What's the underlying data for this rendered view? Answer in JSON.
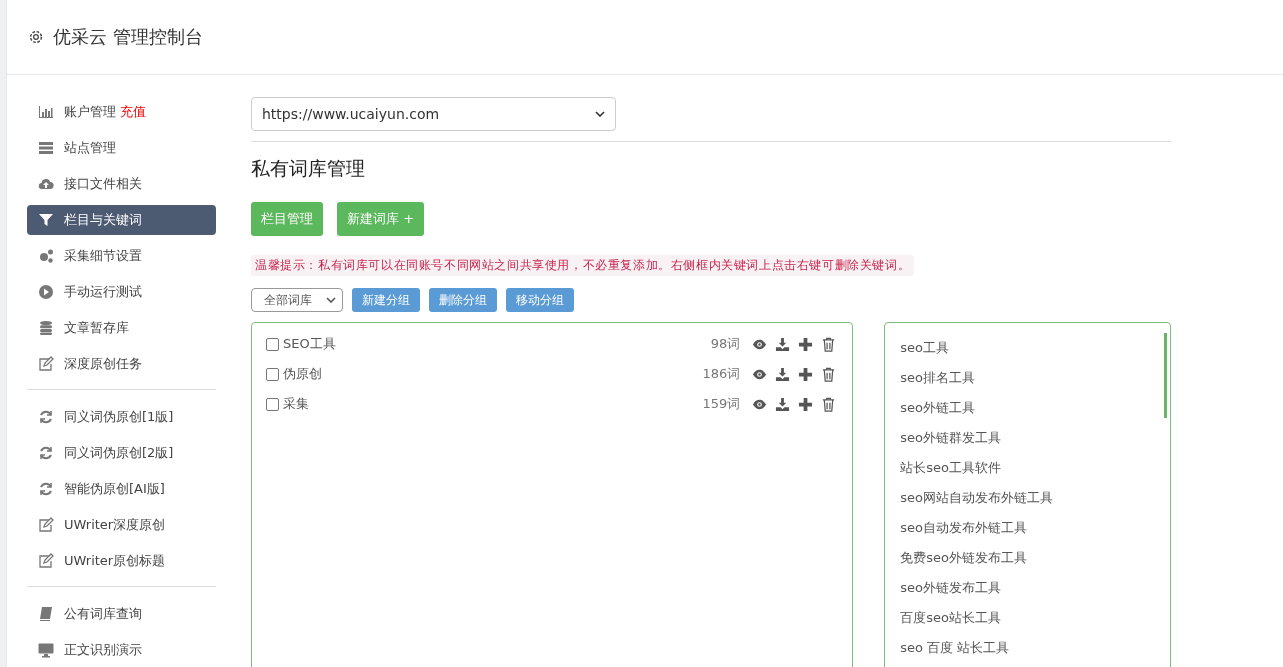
{
  "header": {
    "title": "优采云 管理控制台"
  },
  "sidebar": {
    "groups": [
      {
        "items": [
          {
            "label": "账户管理",
            "badge": "充值",
            "kind": "chart",
            "selected": false
          },
          {
            "label": "站点管理",
            "kind": "server",
            "selected": false
          },
          {
            "label": "接口文件相关",
            "kind": "cloud",
            "selected": false
          },
          {
            "label": "栏目与关键词",
            "kind": "filter",
            "selected": true
          },
          {
            "label": "采集细节设置",
            "kind": "gears",
            "selected": false
          },
          {
            "label": "手动运行测试",
            "kind": "play",
            "selected": false
          },
          {
            "label": "文章暂存库",
            "kind": "db",
            "selected": false
          },
          {
            "label": "深度原创任务",
            "kind": "edit",
            "selected": false
          }
        ]
      },
      {
        "items": [
          {
            "label": "同义词伪原创[1版]",
            "kind": "refresh",
            "selected": false
          },
          {
            "label": "同义词伪原创[2版]",
            "kind": "refresh",
            "selected": false
          },
          {
            "label": "智能伪原创[AI版]",
            "kind": "refresh",
            "selected": false
          },
          {
            "label": "UWriter深度原创",
            "kind": "edit",
            "selected": false
          },
          {
            "label": "UWriter原创标题",
            "kind": "edit",
            "selected": false
          }
        ]
      },
      {
        "items": [
          {
            "label": "公有词库查询",
            "kind": "book",
            "selected": false
          },
          {
            "label": "正文识别演示",
            "kind": "monitor",
            "selected": false
          }
        ]
      }
    ]
  },
  "site_select": {
    "value": "https://www.ucaiyun.com"
  },
  "section_title": "私有词库管理",
  "primary_buttons": [
    "栏目管理",
    "新建词库 +"
  ],
  "tip": "温馨提示：私有词库可以在同账号不同网站之间共享使用，不必重复添加。右侧框内关键词上点击右键可删除关键词。",
  "group_select": {
    "value": "全部词库"
  },
  "group_buttons": [
    "新建分组",
    "删除分组",
    "移动分组"
  ],
  "libraries": [
    {
      "name": "SEO工具",
      "count": "98词",
      "checked": false
    },
    {
      "name": "伪原创",
      "count": "186词",
      "checked": false
    },
    {
      "name": "采集",
      "count": "159词",
      "checked": false
    }
  ],
  "keywords": [
    "seo工具",
    "seo排名工具",
    "seo外链工具",
    "seo外链群发工具",
    "站长seo工具软件",
    "seo网站自动发布外链工具",
    "seo自动发布外链工具",
    "免费seo外链发布工具",
    "seo外链发布工具",
    "百度seo站长工具",
    "seo 百度 站长工具"
  ]
}
